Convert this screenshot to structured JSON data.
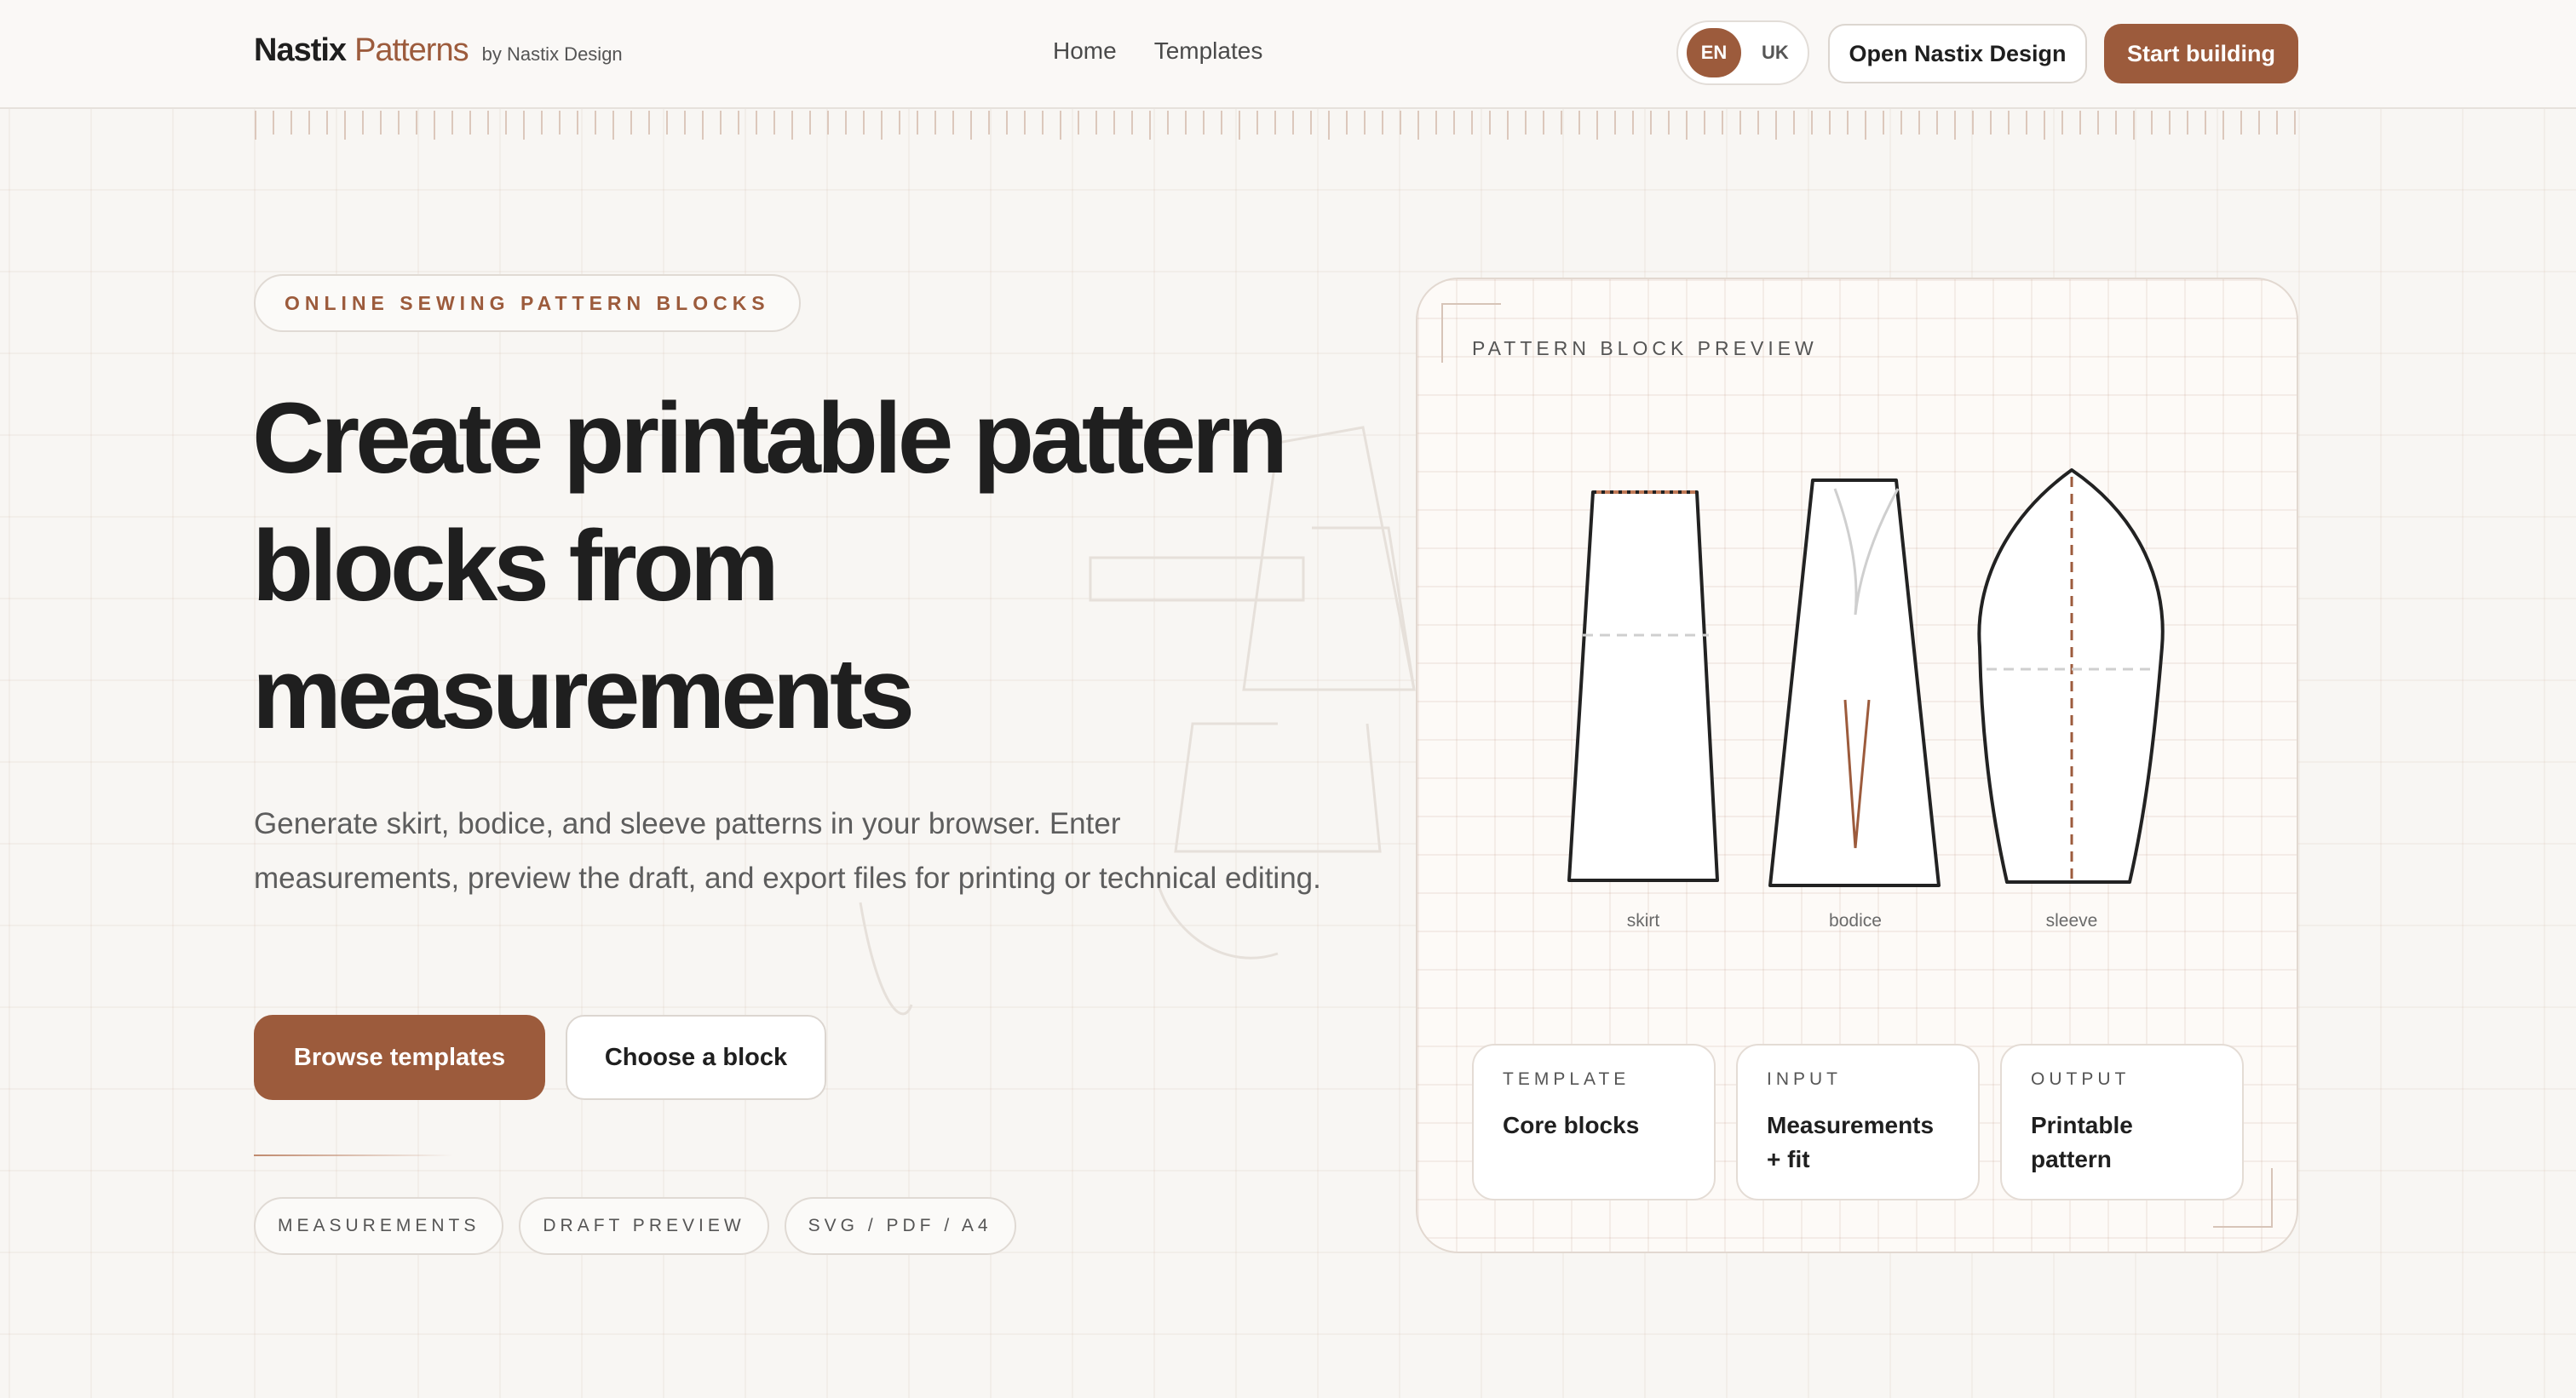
{
  "header": {
    "brand": "Nastix",
    "brand_accent": "Patterns",
    "brand_by": "by Nastix Design",
    "nav": [
      "Home",
      "Templates"
    ],
    "lang_active": "EN",
    "lang_other": "UK",
    "open_label": "Open Nastix Design",
    "start_label": "Start building"
  },
  "hero": {
    "eyebrow": "ONLINE SEWING PATTERN BLOCKS",
    "title_lines": [
      "Create printable pattern",
      "blocks from",
      "measurements"
    ],
    "subtitle": "Generate skirt, bodice, and sleeve patterns in your browser. Enter measurements, preview the draft, and export files for printing or technical editing.",
    "primary_button": "Browse templates",
    "secondary_button": "Choose a block",
    "chips": [
      "MEASUREMENTS",
      "DRAFT PREVIEW",
      "SVG / PDF / A4"
    ]
  },
  "preview": {
    "title": "PATTERN BLOCK PREVIEW",
    "blocks": [
      "skirt",
      "bodice",
      "sleeve"
    ],
    "info": [
      {
        "label": "TEMPLATE",
        "value": "Core blocks"
      },
      {
        "label": "INPUT",
        "value": "Measurements + fit"
      },
      {
        "label": "OUTPUT",
        "value": "Printable pattern"
      }
    ]
  },
  "colors": {
    "accent": "#9c5b3c",
    "text": "#1f1f1f",
    "background": "#f8f6f3"
  }
}
